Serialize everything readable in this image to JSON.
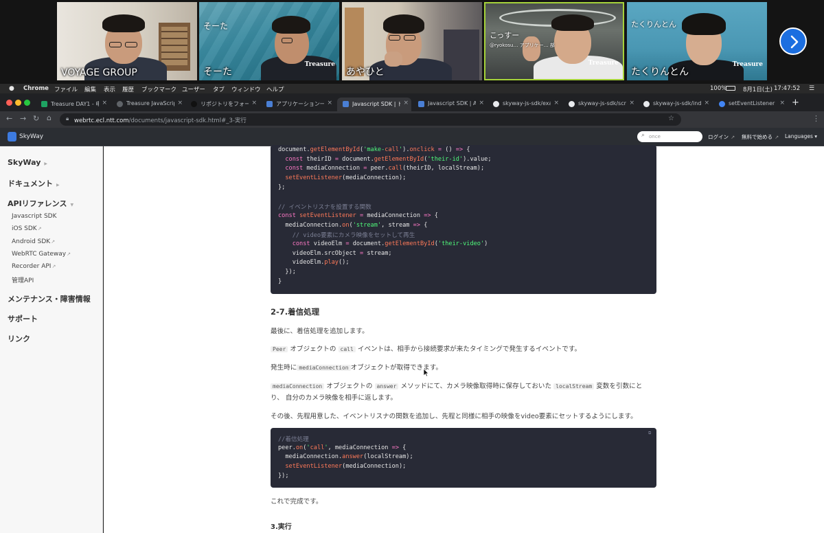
{
  "video_call": {
    "participants": [
      {
        "name": "VOYAGE GROUP",
        "top_label": "",
        "sub": "",
        "watermark": ""
      },
      {
        "name": "そーた",
        "top_label": "そーた",
        "sub": "",
        "watermark": "Treasure"
      },
      {
        "name": "あやひと",
        "top_label": "",
        "sub": "",
        "watermark": ""
      },
      {
        "name": "",
        "top_label": "こっすー",
        "sub": "@ryokosu… アプリケー… 部",
        "watermark": "Treasure"
      },
      {
        "name": "たくりんとん",
        "top_label": "たくりんとん",
        "sub": "",
        "watermark": "Treasure"
      }
    ],
    "active_speaker_color": "#a6d33a"
  },
  "menubar": {
    "apple": "",
    "app": "Chrome",
    "items": [
      "ファイル",
      "編集",
      "表示",
      "履歴",
      "ブックマーク",
      "ユーザー",
      "タブ",
      "ウィンドウ",
      "ヘルプ"
    ],
    "battery": "100%",
    "date": "8月1日(土)",
    "time": "17:47:52"
  },
  "tabs": [
    {
      "label": "Treasure DAY1 - 申請",
      "icon": "sheets-icon",
      "color": "#1ea362"
    },
    {
      "label": "Treasure JavaScript",
      "icon": "globe-icon",
      "color": "#5f6368"
    },
    {
      "label": "リポジトリをフォーク",
      "icon": "github-icon",
      "color": "#111"
    },
    {
      "label": "アプリケーション一覧",
      "icon": "skyway-icon",
      "color": "#4a7fd4"
    },
    {
      "label": "Javascript SDK | ドキ",
      "icon": "skyway-icon",
      "color": "#4a7fd4"
    },
    {
      "label": "Javascript SDK | API",
      "icon": "skyway-icon",
      "color": "#4a7fd4"
    },
    {
      "label": "skyway-js-sdk/exam",
      "icon": "github-icon",
      "color": "#e8eaed"
    },
    {
      "label": "skyway-js-sdk/scrip",
      "icon": "github-icon",
      "color": "#e8eaed"
    },
    {
      "label": "skyway-js-sdk/inde",
      "icon": "github-icon",
      "color": "#e8eaed"
    },
    {
      "label": "setEventListener -",
      "icon": "google-icon",
      "color": "#4285f4"
    }
  ],
  "active_tab_index": 4,
  "new_tab": "+",
  "address": {
    "host": "webrtc.ecl.ntt.com",
    "path": "/documents/javascript-sdk.html#_3-実行"
  },
  "site": {
    "logo": "SkyWay",
    "search_placeholder": "once",
    "login": "ログイン",
    "signup": "無料で始める",
    "languages": "Languages"
  },
  "sidebar": {
    "sections": [
      "SkyWay",
      "ドキュメント",
      "APIリファレンス"
    ],
    "api_items": [
      "Javascript SDK",
      "iOS SDK",
      "Android SDK",
      "WebRTC Gateway",
      "Recorder API",
      "管理API"
    ],
    "bottom_sections": [
      "メンテナンス・障害情報",
      "サポート",
      "リンク"
    ]
  },
  "content": {
    "code1": [
      "document.getElementById('make-call').onclick = () => {",
      "  const theirID = document.getElementById('their-id').value;",
      "  const mediaConnection = peer.call(theirID, localStream);",
      "  setEventListener(mediaConnection);",
      "};",
      "",
      "// イベントリスナを設置する関数",
      "const setEventListener = mediaConnection => {",
      "  mediaConnection.on('stream', stream => {",
      "    // video要素にカメラ映像をセットして再生",
      "    const videoElm = document.getElementById('their-video')",
      "    videoElm.srcObject = stream;",
      "    videoElm.play();",
      "  });",
      "}"
    ],
    "heading": "2-7.着信処理",
    "p1": "最後に、着信処理を追加します。",
    "p2_code1": "Peer",
    "p2_a": "オブジェクトの",
    "p2_code2": "call",
    "p2_b": "イベントは、相手から接続要求が来たタイミングで発生するイベントです。",
    "p3_a": "発生時に",
    "p3_code": "mediaConnection",
    "p3_b": "オブジェクトが取得できます。",
    "p4_code1": "mediaConnection",
    "p4_a": "オブジェクトの",
    "p4_code2": "answer",
    "p4_b": "メソッドにて、カメラ映像取得時に保存しておいた",
    "p4_code3": "localStream",
    "p4_c": "変数を引数にと",
    "p4_d": "り、 自分のカメラ映像を相手に返します。",
    "p5": "その後、先程用意した、イベントリスナの関数を追加し、先程と同様に相手の映像をvideo要素にセットするようにします。",
    "code2": [
      "//着信処理",
      "peer.on('call', mediaConnection => {",
      "  mediaConnection.answer(localStream);",
      "  setEventListener(mediaConnection);",
      "});"
    ],
    "p6": "これで完成です。",
    "heading2": "3.実行"
  }
}
